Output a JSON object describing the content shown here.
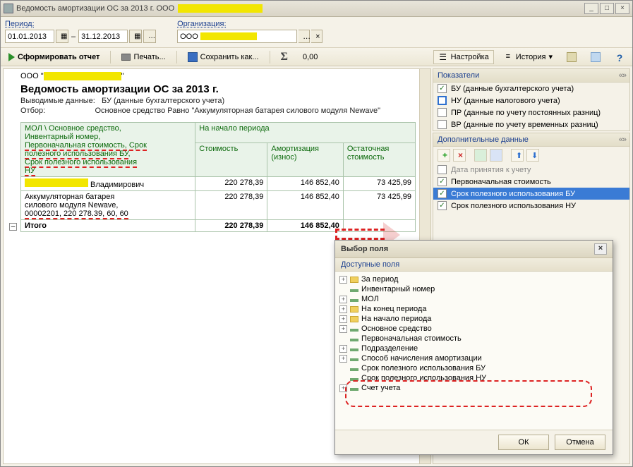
{
  "window": {
    "title_prefix": "Ведомость амортизации ОС за 2013 г. ООО"
  },
  "filters": {
    "period_label": "Период:",
    "date_from": "01.01.2013",
    "date_sep": "–",
    "date_to": "31.12.2013",
    "org_label": "Организация:",
    "org_prefix": "ООО"
  },
  "toolbar": {
    "generate": "Сформировать отчет",
    "print": "Печать...",
    "save": "Сохранить как...",
    "sigma_value": "0,00",
    "settings": "Настройка",
    "history": "История"
  },
  "report": {
    "org_prefix": "ООО \"",
    "org_suffix": "\"",
    "title": "Ведомость амортизации ОС за 2013 г.",
    "out_label": "Выводимые данные:",
    "out_value": "БУ (данные бухгалтерского учета)",
    "filter_label": "Отбор:",
    "filter_value": "Основное средство Равно \"Аккумуляторная батарея силового модуля Newave\"",
    "headers": {
      "left1": "МОЛ \\ Основное средство,",
      "left2": "Инвентарный номер,",
      "left3": "Первоначальная стоимость,",
      "left4": "Срок",
      "left5": "полезного использования БУ",
      "left6": "Срок полезного использования",
      "left7": "НУ",
      "period": "На начало периода",
      "cost": "Стоимость",
      "amort1": "Амортизация",
      "amort2": "(износ)",
      "resid1": "Остаточная",
      "resid2": "стоимость"
    },
    "rows": [
      {
        "mol_suffix": " Владимирович",
        "asset_l1": "Аккумуляторная батарея",
        "asset_l2": "силового модуля Newave,",
        "asset_l3": "00002201, 220 278.39, 60, 60",
        "cost": "220 278,39",
        "amort": "146 852,40",
        "resid": "73 425,99"
      }
    ],
    "row2": {
      "cost": "220 278,39",
      "amort": "146 852,40",
      "resid": "73 425,99"
    },
    "total_label": "Итого",
    "total": {
      "cost": "220 278,39",
      "amort": "146 852,40"
    }
  },
  "indicators": {
    "title": "Показатели",
    "items": [
      {
        "label": "БУ (данные бухгалтерского учета)",
        "checked": true,
        "blue": false
      },
      {
        "label": "НУ (данные налогового учета)",
        "checked": false,
        "blue": true
      },
      {
        "label": "ПР (данные по учету постоянных разниц)",
        "checked": false,
        "blue": false
      },
      {
        "label": "ВР (данные по учету временных разниц)",
        "checked": false,
        "blue": false
      }
    ]
  },
  "extra": {
    "title": "Дополнительные данные",
    "items": [
      {
        "label": "Дата принятия к учету",
        "checked": false,
        "gray": true,
        "sel": false
      },
      {
        "label": "Первоначальная стоимость",
        "checked": true,
        "gray": false,
        "sel": false
      },
      {
        "label": "Срок полезного использования БУ",
        "checked": true,
        "gray": false,
        "sel": true
      },
      {
        "label": "Срок полезного использования НУ",
        "checked": true,
        "gray": false,
        "sel": false
      }
    ]
  },
  "popup": {
    "title": "Выбор поля",
    "subtitle": "Доступные поля",
    "tree": [
      {
        "exp": "+",
        "type": "folder",
        "label": "За период"
      },
      {
        "exp": "",
        "type": "item",
        "label": "Инвентарный номер"
      },
      {
        "exp": "+",
        "type": "item",
        "label": "МОЛ"
      },
      {
        "exp": "+",
        "type": "folder",
        "label": "На конец периода"
      },
      {
        "exp": "+",
        "type": "folder",
        "label": "На начало периода"
      },
      {
        "exp": "+",
        "type": "item",
        "label": "Основное средство"
      },
      {
        "exp": "",
        "type": "item",
        "label": "Первоначальная стоимость"
      },
      {
        "exp": "+",
        "type": "item",
        "label": "Подразделение"
      },
      {
        "exp": "+",
        "type": "item",
        "label": "Способ начисления амортизации"
      },
      {
        "exp": "",
        "type": "item",
        "label": "Срок полезного использования БУ"
      },
      {
        "exp": "",
        "type": "item",
        "label": "Срок полезного использования НУ"
      },
      {
        "exp": "+",
        "type": "item",
        "label": "Счет учета"
      }
    ],
    "ok": "ОК",
    "cancel": "Отмена"
  }
}
